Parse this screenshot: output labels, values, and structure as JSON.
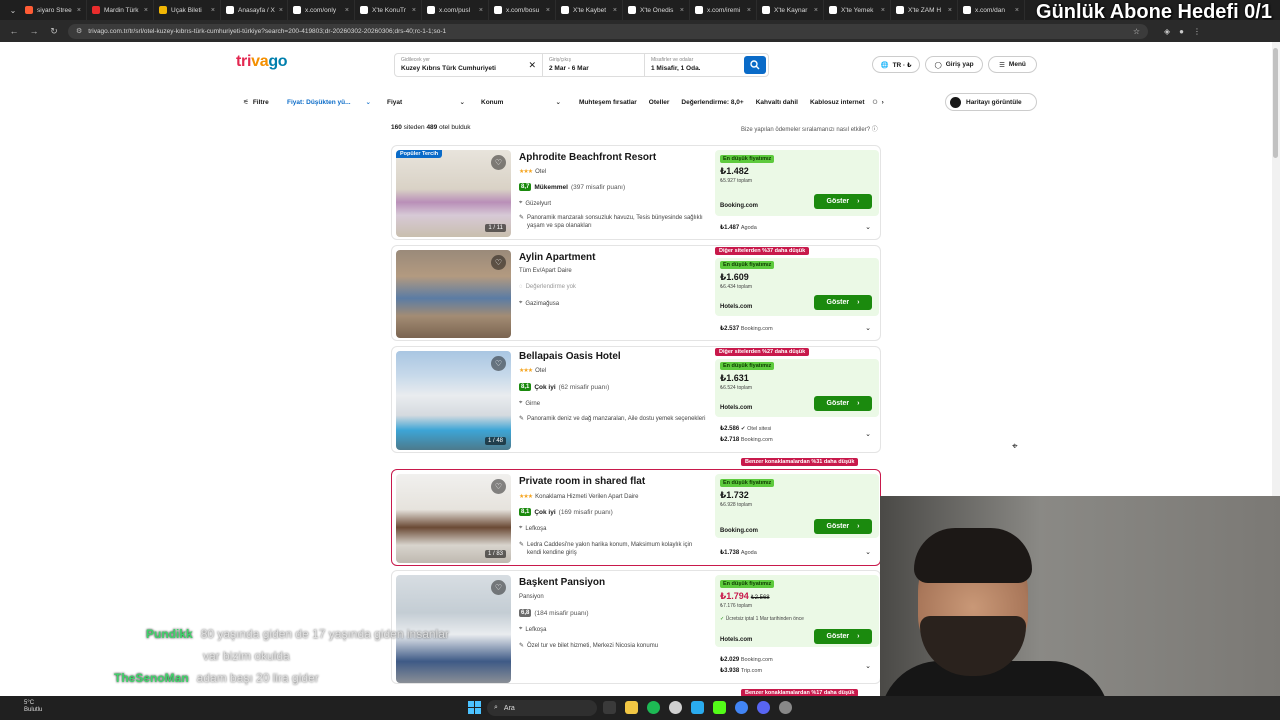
{
  "browser": {
    "tabs": [
      {
        "label": "siyaro Stree",
        "color": "#ff5c35"
      },
      {
        "label": "Mardin Türk",
        "color": "#e82c2c"
      },
      {
        "label": "Uçak Bileti",
        "color": "#f2b705"
      },
      {
        "label": "Anasayfa / X",
        "color": "#ffffff"
      },
      {
        "label": "x.com/only",
        "color": "#ffffff"
      },
      {
        "label": "X'te KonuTr",
        "color": "#ffffff"
      },
      {
        "label": "x.com/pusl",
        "color": "#ffffff"
      },
      {
        "label": "x.com/bosu",
        "color": "#ffffff"
      },
      {
        "label": "X'te Kaybet",
        "color": "#ffffff"
      },
      {
        "label": "X'te Onedis",
        "color": "#ffffff"
      },
      {
        "label": "x.com/iremi",
        "color": "#ffffff"
      },
      {
        "label": "X'te Kaynar",
        "color": "#ffffff"
      },
      {
        "label": "X'te Yemek",
        "color": "#ffffff"
      },
      {
        "label": "X'te ZAM H",
        "color": "#ffffff"
      },
      {
        "label": "x.com/dan",
        "color": "#ffffff"
      }
    ],
    "url": "trivago.com.tr/tr/srl/otel-kuzey-kıbrıs-türk-cumhuriyeti-türkiye?search=200-419803;dr-20260302-20260306;drs-40;rc-1-1;so-1"
  },
  "overlay": {
    "goal_text": "Günlük Abone Hedefi 0/1"
  },
  "header": {
    "logo": {
      "part1": "tri",
      "part2": "va",
      "part3": "go"
    },
    "search": {
      "destination_label": "Gidilecek yer",
      "destination_value": "Kuzey Kıbrıs Türk Cumhuriyeti",
      "dates_label": "Giriş/çıkış",
      "dates_value": "2 Mar - 6 Mar",
      "guests_label": "Misafirler ve odalar",
      "guests_value": "1 Misafir, 1 Oda."
    },
    "lang_label": "TR · ₺",
    "login_label": "Giriş yap",
    "menu_label": "Menü"
  },
  "filters": {
    "filter_label": "Filtre",
    "sort_label": "Fiyat: Düşükten yü...",
    "price_label": "Fiyat",
    "location_label": "Konum",
    "chips": [
      "Muhteşem fırsatlar",
      "Oteller",
      "Değerlendirme: 8,0+",
      "Kahvaltı dahil",
      "Kablosuz internet",
      "O"
    ],
    "map_label": "Haritayı görüntüle"
  },
  "results": {
    "count_a": "160",
    "count_mid": " siteden ",
    "count_b": "489",
    "count_tail": " otel bulduk",
    "disclaimer": "Bize yapılan ödemeler sıralamanızı nasıl etkiler? ⓘ"
  },
  "hotels": [
    {
      "name": "Aphrodite Beachfront Resort",
      "type": "Otel",
      "stars": "★★★",
      "rating": "8,7",
      "rating_label": "Mükemmel",
      "rating_count": "(397 misafir puanı)",
      "rating_color": "#1b8a0e",
      "location": "Güzelyurt",
      "desc": "Panoramik manzaralı sonsuzluk havuzu, Tesis bünyesinde sağlıklı yaşam ve spa olanakları",
      "photo_count": "1 / 11",
      "popular_tag": "Popüler Tercih",
      "lowest_tag": "En düşük fiyatımız",
      "price": "₺1.482",
      "total": "₺5.927 toplam",
      "provider": "Booking.com",
      "button": "Göster",
      "alt_price": "₺1.487",
      "alt_provider": "Agoda"
    },
    {
      "name": "Aylin Apartment",
      "type": "Tüm Ev/Apart Daire",
      "rating_none": "Değerlendirme yok",
      "location": "Gazimağusa",
      "red_tag": "Diğer sitelerden %37 daha düşük",
      "lowest_tag": "En düşük fiyatımız",
      "price": "₺1.609",
      "total": "₺6.434 toplam",
      "provider": "Hotels.com",
      "button": "Göster",
      "alt_price": "₺2.537",
      "alt_provider": "Booking.com"
    },
    {
      "name": "Bellapais Oasis Hotel",
      "type": "Otel",
      "stars": "★★★",
      "rating": "8,1",
      "rating_label": "Çok iyi",
      "rating_count": "(62 misafir puanı)",
      "rating_color": "#1b8a0e",
      "location": "Girne",
      "desc": "Panoramik deniz ve dağ manzaraları, Aile dostu yemek seçenekleri",
      "photo_count": "1 / 48",
      "red_tag": "Diğer sitelerden %27 daha düşük",
      "lowest_tag": "En düşük fiyatımız",
      "price": "₺1.631",
      "total": "₺6.524 toplam",
      "provider": "Hotels.com",
      "button": "Göster",
      "alt_price": "₺2.586",
      "alt_provider": "Otel sitesi",
      "alt2_price": "₺2.718",
      "alt2_provider": "Booking.com"
    },
    {
      "name": "Private room in shared flat",
      "type": "Konaklama Hizmeti Verilen Apart Daire",
      "stars": "★★★",
      "rating": "8,1",
      "rating_label": "Çok iyi",
      "rating_count": "(169 misafir puanı)",
      "rating_color": "#1b8a0e",
      "location": "Lefkoşa",
      "desc": "Ledra Caddesi'ne yakın harika konum, Maksimum kolaylık için kendi kendine giriş",
      "photo_count": "1 / 83",
      "red_tag": "Benzer konaklamalardan %31 daha düşük",
      "lowest_tag": "En düşük fiyatımız",
      "price": "₺1.732",
      "total": "₺6.928 toplam",
      "provider": "Booking.com",
      "button": "Göster",
      "alt_price": "₺1.738",
      "alt_provider": "Agoda"
    },
    {
      "name": "Başkent Pansiyon",
      "type": "Pansiyon",
      "rating": "6,8",
      "rating_count": "(184 misafir puanı)",
      "rating_color": "#6b6b6b",
      "location": "Lefkoşa",
      "desc": "Özel tur ve bilet hizmeti, Merkezi Nicosia konumu",
      "lowest_tag": "En düşük fiyatımız",
      "price": "₺1.794",
      "old_price": "₺2.568",
      "total": "₺7.176 toplam",
      "cancel": "Ücretsiz iptal 1 Mar tarihinden önce",
      "provider": "Hotels.com",
      "button": "Göster",
      "alt_price": "₺2.029",
      "alt_provider": "Booking.com",
      "alt2_price": "₺3.938",
      "alt2_provider": "Trip.com"
    }
  ],
  "next_red_tag": "Benzer konaklamalardan %17 daha düşük",
  "chat": [
    {
      "user": "Pundikk",
      "line1": "80 yaşında giden de 17 yaşında giden insanlar",
      "line2": "var bizim okulda"
    },
    {
      "user": "TheSenoMan",
      "line1": "adam başı 20 lira gider"
    }
  ],
  "taskbar": {
    "temp": "5°C",
    "weather": "Bulutlu",
    "search": "Ara"
  }
}
